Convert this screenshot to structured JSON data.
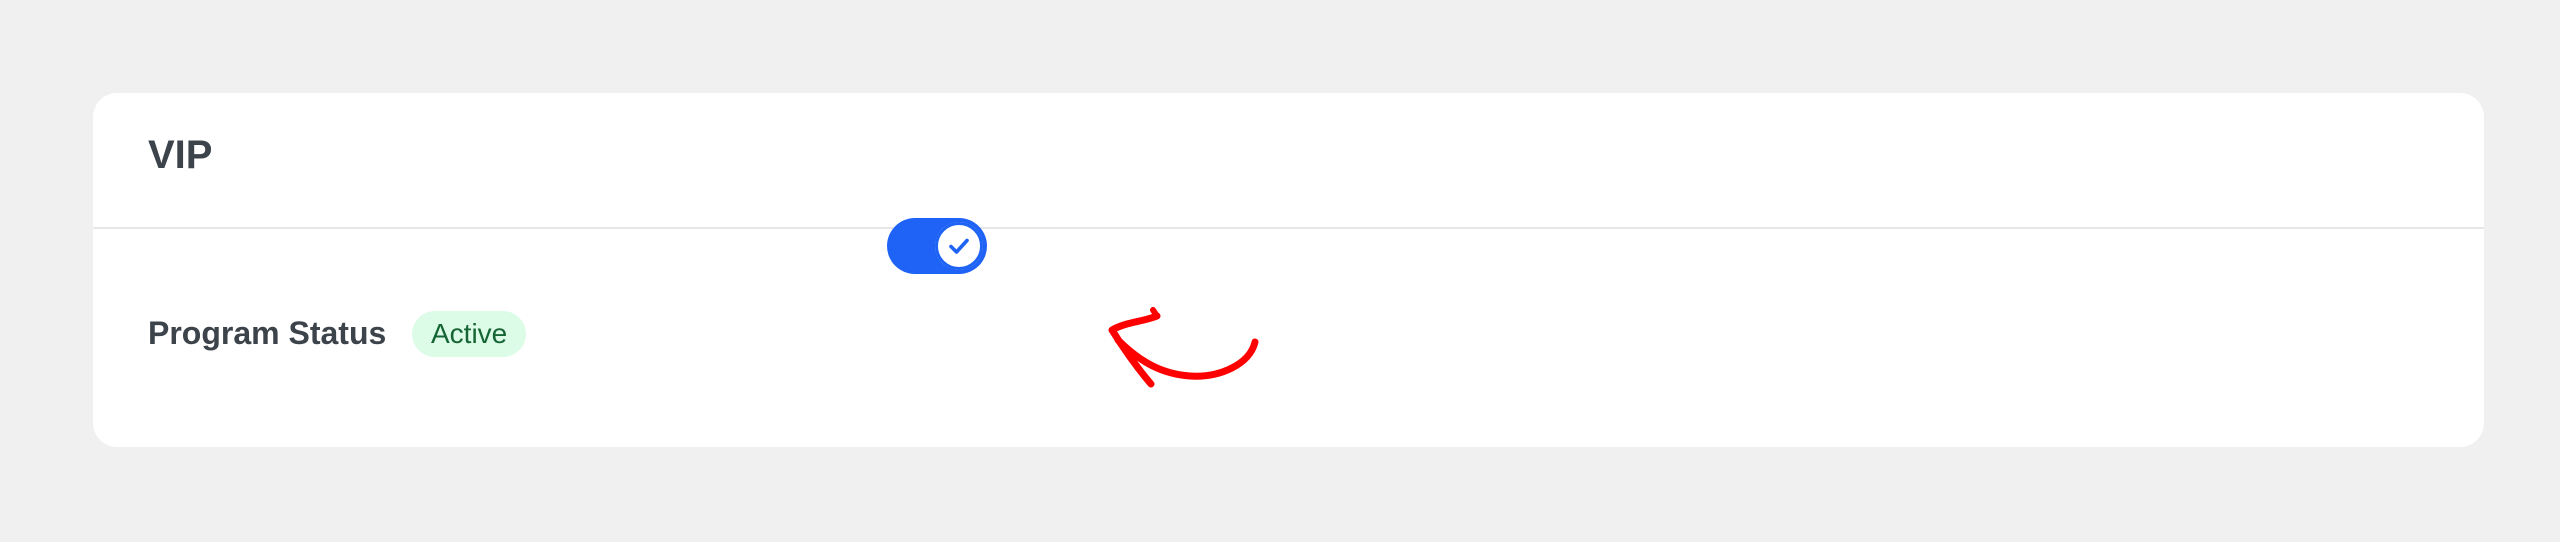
{
  "card": {
    "title": "VIP"
  },
  "program_status": {
    "label": "Program Status",
    "badge": "Active",
    "badge_bg": "#dcfce7",
    "badge_text": "#166534"
  },
  "toggle": {
    "state": "on",
    "on_color": "#1e63f5",
    "icon": "check-icon"
  },
  "annotation": {
    "color": "#ff0000",
    "icon": "hand-drawn-arrow"
  }
}
